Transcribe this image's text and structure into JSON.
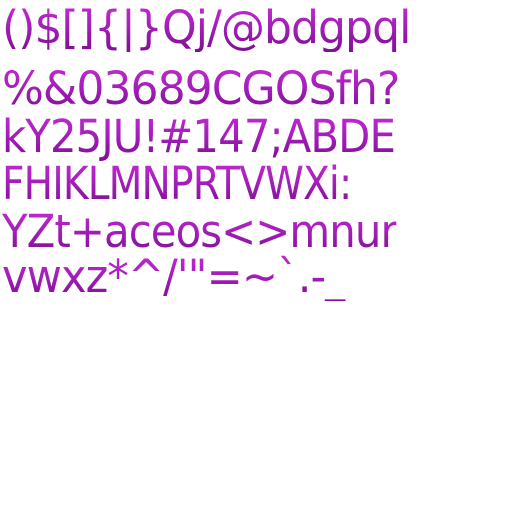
{
  "glyph_rows": [
    "()$[]{|}Qj/@bdgpql",
    "%&03689CGOSfh?",
    "kY25JU!#147;ABDE",
    "FHIKLMNPRTVWXi:",
    "YZt+aceos<>mnur",
    "vwxz*^/'\"=~`.-_"
  ],
  "colors": {
    "background": "#ffffff",
    "glyph_gradient_top": "#c42ad2",
    "glyph_gradient_bottom": "#7e0f94"
  }
}
